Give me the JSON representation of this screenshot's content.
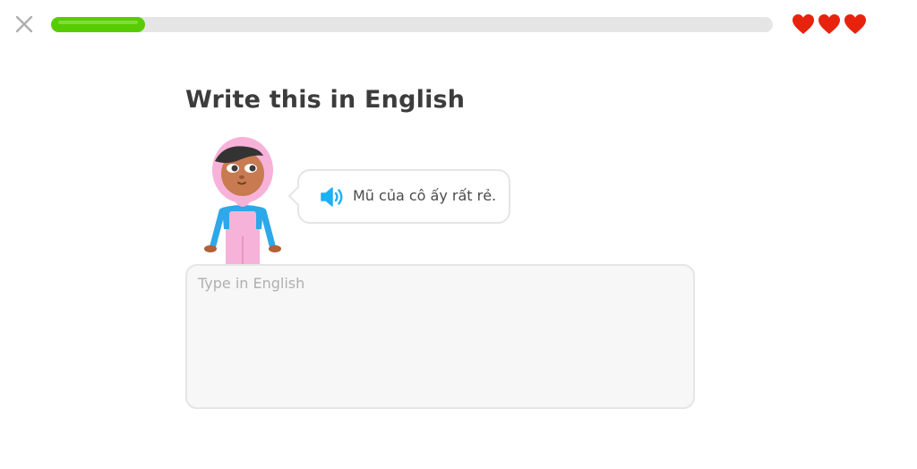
{
  "header": {
    "close_icon": "close-icon",
    "progress_fraction": 0.13,
    "progress_color": "#58cc02",
    "hearts": [
      {
        "icon": "heart-icon",
        "color": "#e8230d"
      },
      {
        "icon": "heart-icon",
        "color": "#e8230d"
      },
      {
        "icon": "heart-icon",
        "color": "#e8230d"
      }
    ]
  },
  "challenge": {
    "title": "Write this in English",
    "speaker_icon": "speaker-icon",
    "sentence": "Mũ của cô ấy rất rẻ.",
    "answer": {
      "value": "",
      "placeholder": "Type in English"
    }
  }
}
